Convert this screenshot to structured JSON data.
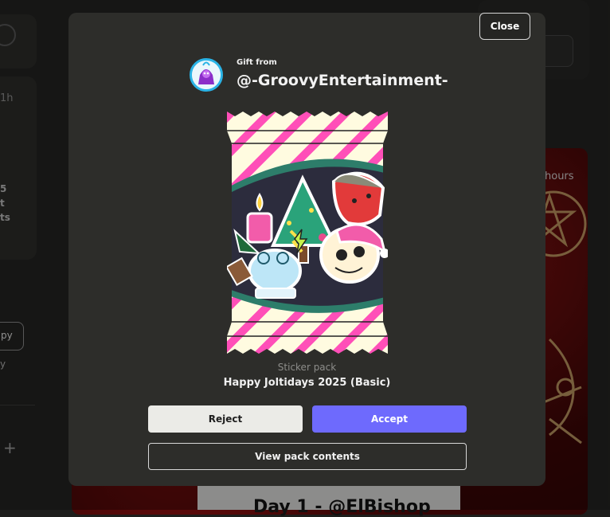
{
  "background": {
    "time_label": "1h",
    "number_label": "5\nt\nts",
    "pill_label": "py",
    "side_text": "y",
    "plus": "+",
    "hours_label": "hours",
    "strip_text": "Day 1 - @ElBishop"
  },
  "modal": {
    "close_label": "Close",
    "gift_from_label": "Gift from",
    "gifter_name": "@-GroovyEntertainment-",
    "pack_type": "Sticker pack",
    "pack_name": "Happy Joltidays 2025 (Basic)",
    "reject_label": "Reject",
    "accept_label": "Accept",
    "view_label": "View pack contents"
  },
  "colors": {
    "modal_bg": "#2d2d2a",
    "accept": "#6e6afd",
    "reject": "#ebebe7",
    "pack_stripe": "#ff4fb8",
    "pack_base": "#fffbe0",
    "avatar_ring": "#2ab3e6"
  },
  "icons": {
    "avatar": "gifter-avatar",
    "stickers": [
      "candle-icon",
      "christmas-tree-icon",
      "red-mask-icon",
      "skull-santa-icon",
      "frog-snowglobe-icon"
    ]
  }
}
